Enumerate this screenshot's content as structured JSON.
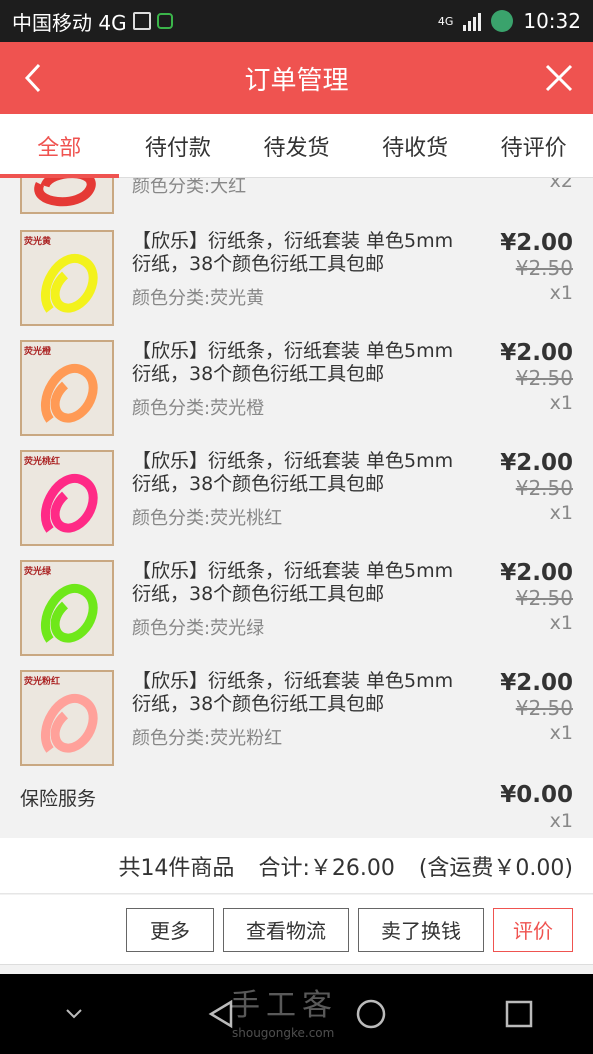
{
  "status_bar": {
    "carrier": "中国移动 4G",
    "network": "4G",
    "time": "10:32"
  },
  "header": {
    "title": "订单管理",
    "back_icon": "chevron-left-icon",
    "close_icon": "close-icon"
  },
  "tabs": [
    {
      "label": "全部",
      "active": true
    },
    {
      "label": "待付款",
      "active": false
    },
    {
      "label": "待发货",
      "active": false
    },
    {
      "label": "待收货",
      "active": false
    },
    {
      "label": "待评价",
      "active": false
    }
  ],
  "partial_item": {
    "sku": "颜色分类:大红",
    "qty": "x2"
  },
  "items": [
    {
      "tag": "荧光黄",
      "color": "#f3f21c",
      "name": "【欣乐】衍纸条，衍纸套装 单色5mm衍纸，38个颜色衍纸工具包邮",
      "sku": "颜色分类:荧光黄",
      "price": "¥2.00",
      "original_price": "¥2.50",
      "qty": "x1"
    },
    {
      "tag": "荧光橙",
      "color": "#ff9a55",
      "name": "【欣乐】衍纸条，衍纸套装 单色5mm衍纸，38个颜色衍纸工具包邮",
      "sku": "颜色分类:荧光橙",
      "price": "¥2.00",
      "original_price": "¥2.50",
      "qty": "x1"
    },
    {
      "tag": "荧光桃红",
      "color": "#ff2a86",
      "name": "【欣乐】衍纸条，衍纸套装 单色5mm衍纸，38个颜色衍纸工具包邮",
      "sku": "颜色分类:荧光桃红",
      "price": "¥2.00",
      "original_price": "¥2.50",
      "qty": "x1"
    },
    {
      "tag": "荧光绿",
      "color": "#6fe81a",
      "name": "【欣乐】衍纸条，衍纸套装 单色5mm衍纸，38个颜色衍纸工具包邮",
      "sku": "颜色分类:荧光绿",
      "price": "¥2.00",
      "original_price": "¥2.50",
      "qty": "x1"
    },
    {
      "tag": "荧光粉红",
      "color": "#ffa19a",
      "name": "【欣乐】衍纸条，衍纸套装 单色5mm衍纸，38个颜色衍纸工具包邮",
      "sku": "颜色分类:荧光粉红",
      "price": "¥2.00",
      "original_price": "¥2.50",
      "qty": "x1"
    }
  ],
  "insurance": {
    "label": "保险服务",
    "price": "¥0.00",
    "qty": "x1"
  },
  "summary": {
    "count_text": "共14件商品",
    "total_text": "合计:￥26.00",
    "shipping_text": "(含运费￥0.00)"
  },
  "actions": {
    "more": "更多",
    "logistics": "查看物流",
    "resell": "卖了换钱",
    "review": "评价"
  },
  "watermark": {
    "title": "手工客",
    "url": "shougongke.com"
  },
  "colors": {
    "accent": "#ef5350",
    "status_bar": "#1d1d1d"
  }
}
